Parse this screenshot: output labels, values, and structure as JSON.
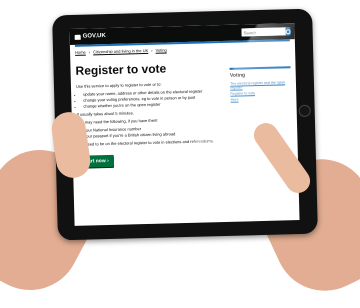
{
  "header": {
    "logo_text": "GOV.UK",
    "search_placeholder": "Search"
  },
  "breadcrumb": [
    "Home",
    "Citizenship and living in the UK",
    "Voting"
  ],
  "page": {
    "title": "Register to vote",
    "intro": "Use this service to apply to register to vote or to:",
    "bullets": [
      "update your name, address or other details on the electoral register",
      "change your voting preferences, eg to vote in person or by post",
      "change whether you're on the open register"
    ],
    "duration": "It usually takes about 5 minutes.",
    "need_intro": "You may need the following, if you have them:",
    "needs": [
      "your National Insurance number",
      "your passport if you're a British citizen living abroad"
    ],
    "age_note": "You need to be on the electoral register to vote in elections and referendums.",
    "start_button": "Start now"
  },
  "sidebar": {
    "title": "Voting",
    "links": [
      "The electoral register and the 'open register'",
      "Register to vote",
      "More"
    ]
  },
  "colors": {
    "header_bg": "#0b0c0c",
    "link": "#1d70b8",
    "start_button": "#00703c"
  }
}
